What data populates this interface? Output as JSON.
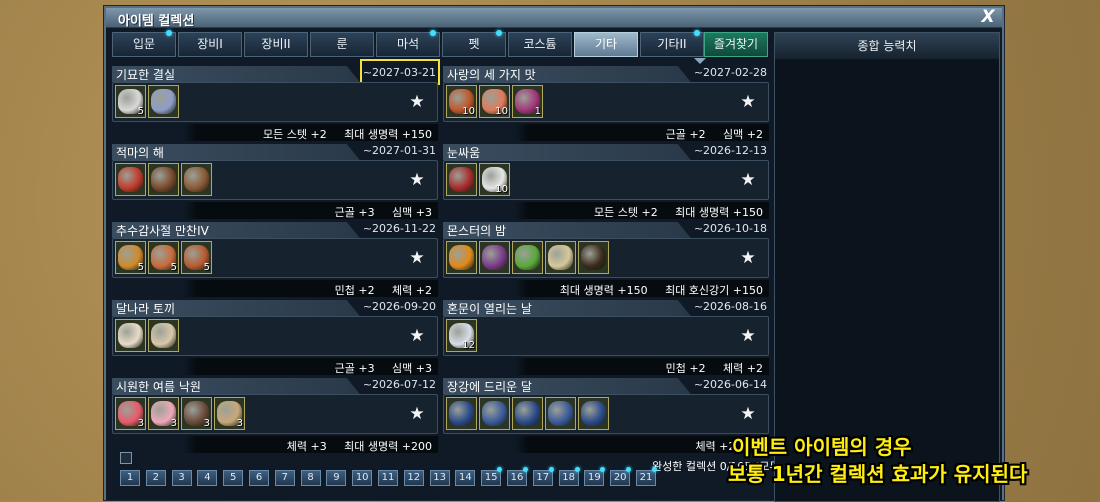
{
  "window": {
    "title": "아이템 컬렉션",
    "close_label": "X"
  },
  "tabs": [
    {
      "label": "입문",
      "dot": true
    },
    {
      "label": "장비I",
      "dot": false
    },
    {
      "label": "장비II",
      "dot": false
    },
    {
      "label": "룬",
      "dot": false
    },
    {
      "label": "마석",
      "dot": true
    },
    {
      "label": "펫",
      "dot": true
    },
    {
      "label": "코스튬",
      "dot": false
    },
    {
      "label": "기타",
      "dot": false,
      "active": true
    },
    {
      "label": "기타II",
      "dot": true
    },
    {
      "label": "즐겨찾기",
      "dot": false,
      "fav": true
    }
  ],
  "side": {
    "heading": "종합 능력치"
  },
  "cards": [
    {
      "name": "기묘한 결실",
      "date": "~2027-03-21",
      "stats": "모든 스텟 +2     최대 생명력 +150",
      "highlight": true,
      "items": [
        {
          "qty": "5",
          "color": "#d9d9d9"
        },
        {
          "qty": "",
          "color": "#8e9ec8"
        }
      ]
    },
    {
      "name": "사랑의 세 가지 맛",
      "date": "~2027-02-28",
      "stats": "근골 +2     심맥 +2",
      "items": [
        {
          "qty": "10",
          "color": "#c0562a"
        },
        {
          "qty": "10",
          "color": "#e07a5a"
        },
        {
          "qty": "1",
          "color": "#a3357a"
        }
      ]
    },
    {
      "name": "적마의 해",
      "date": "~2027-01-31",
      "stats": "근골 +3     심맥 +3",
      "items": [
        {
          "qty": "",
          "color": "#c03a2a"
        },
        {
          "qty": "",
          "color": "#7a4a2c"
        },
        {
          "qty": "",
          "color": "#8a5a34"
        }
      ]
    },
    {
      "name": "눈싸움",
      "date": "~2026-12-13",
      "stats": "모든 스텟 +2     최대 생명력 +150",
      "items": [
        {
          "qty": "",
          "color": "#a82a2a"
        },
        {
          "qty": "10",
          "color": "#e6e6e6"
        }
      ]
    },
    {
      "name": "추수감사절 만찬IV",
      "date": "~2026-11-22",
      "stats": "민첩 +2     체력 +2",
      "items": [
        {
          "qty": "5",
          "color": "#d08a2a"
        },
        {
          "qty": "5",
          "color": "#c86a3a"
        },
        {
          "qty": "5",
          "color": "#b85a30"
        }
      ]
    },
    {
      "name": "몬스터의 밤",
      "date": "~2026-10-18",
      "stats": "최대 생명력 +150     최대 호신강기 +150",
      "items": [
        {
          "qty": "",
          "color": "#e08a1a"
        },
        {
          "qty": "",
          "color": "#7a3a8a"
        },
        {
          "qty": "",
          "color": "#5aa83a"
        },
        {
          "qty": "",
          "color": "#d8c89a"
        },
        {
          "qty": "",
          "color": "#3a2a1a"
        }
      ]
    },
    {
      "name": "달나라 토끼",
      "date": "~2026-09-20",
      "stats": "근골 +3     심맥 +3",
      "items": [
        {
          "qty": "",
          "color": "#e8dcc8"
        },
        {
          "qty": "",
          "color": "#d8c8a8"
        }
      ]
    },
    {
      "name": "혼문이 열리는 날",
      "date": "~2026-08-16",
      "stats": "민첩 +2     체력 +2",
      "items": [
        {
          "qty": "12",
          "color": "#d8dde8"
        }
      ]
    },
    {
      "name": "시원한 여름 낙원",
      "date": "~2026-07-12",
      "stats": "체력 +3     최대 생명력 +200",
      "items": [
        {
          "qty": "3",
          "color": "#e85a6a"
        },
        {
          "qty": "3",
          "color": "#f0a8b8"
        },
        {
          "qty": "3",
          "color": "#6a4a3a"
        },
        {
          "qty": "3",
          "color": "#c8a878"
        }
      ]
    },
    {
      "name": "장강에 드리운 달",
      "date": "~2026-06-14",
      "stats": "체력 +2     심",
      "items": [
        {
          "qty": "",
          "color": "#2a4a8a"
        },
        {
          "qty": "",
          "color": "#3a5a9a"
        },
        {
          "qty": "",
          "color": "#2a4a8a"
        },
        {
          "qty": "",
          "color": "#3a5a9a"
        },
        {
          "qty": "",
          "color": "#2a4a8a"
        }
      ]
    }
  ],
  "completion": "완성한 컬렉션 0/105   (모두 적용",
  "pages": [
    {
      "label": "1",
      "dot": false
    },
    {
      "label": "2",
      "dot": false
    },
    {
      "label": "3",
      "dot": false
    },
    {
      "label": "4",
      "dot": false
    },
    {
      "label": "5",
      "dot": false
    },
    {
      "label": "6",
      "dot": false
    },
    {
      "label": "7",
      "dot": false
    },
    {
      "label": "8",
      "dot": false
    },
    {
      "label": "9",
      "dot": false
    },
    {
      "label": "10",
      "dot": false
    },
    {
      "label": "11",
      "dot": false
    },
    {
      "label": "12",
      "dot": false
    },
    {
      "label": "13",
      "dot": false
    },
    {
      "label": "14",
      "dot": false
    },
    {
      "label": "15",
      "dot": true
    },
    {
      "label": "16",
      "dot": true
    },
    {
      "label": "17",
      "dot": true
    },
    {
      "label": "18",
      "dot": true
    },
    {
      "label": "19",
      "dot": true
    },
    {
      "label": "20",
      "dot": true
    },
    {
      "label": "21",
      "dot": true
    }
  ],
  "overlay": {
    "line1": "이벤트 아이템의 경우",
    "line2": "보통 1년간 컬렉션 효과가 유지된다"
  },
  "colors": {
    "highlight": "#f2e23a",
    "overlay_text": "#ffee10",
    "dot": "#3fe0ff"
  }
}
